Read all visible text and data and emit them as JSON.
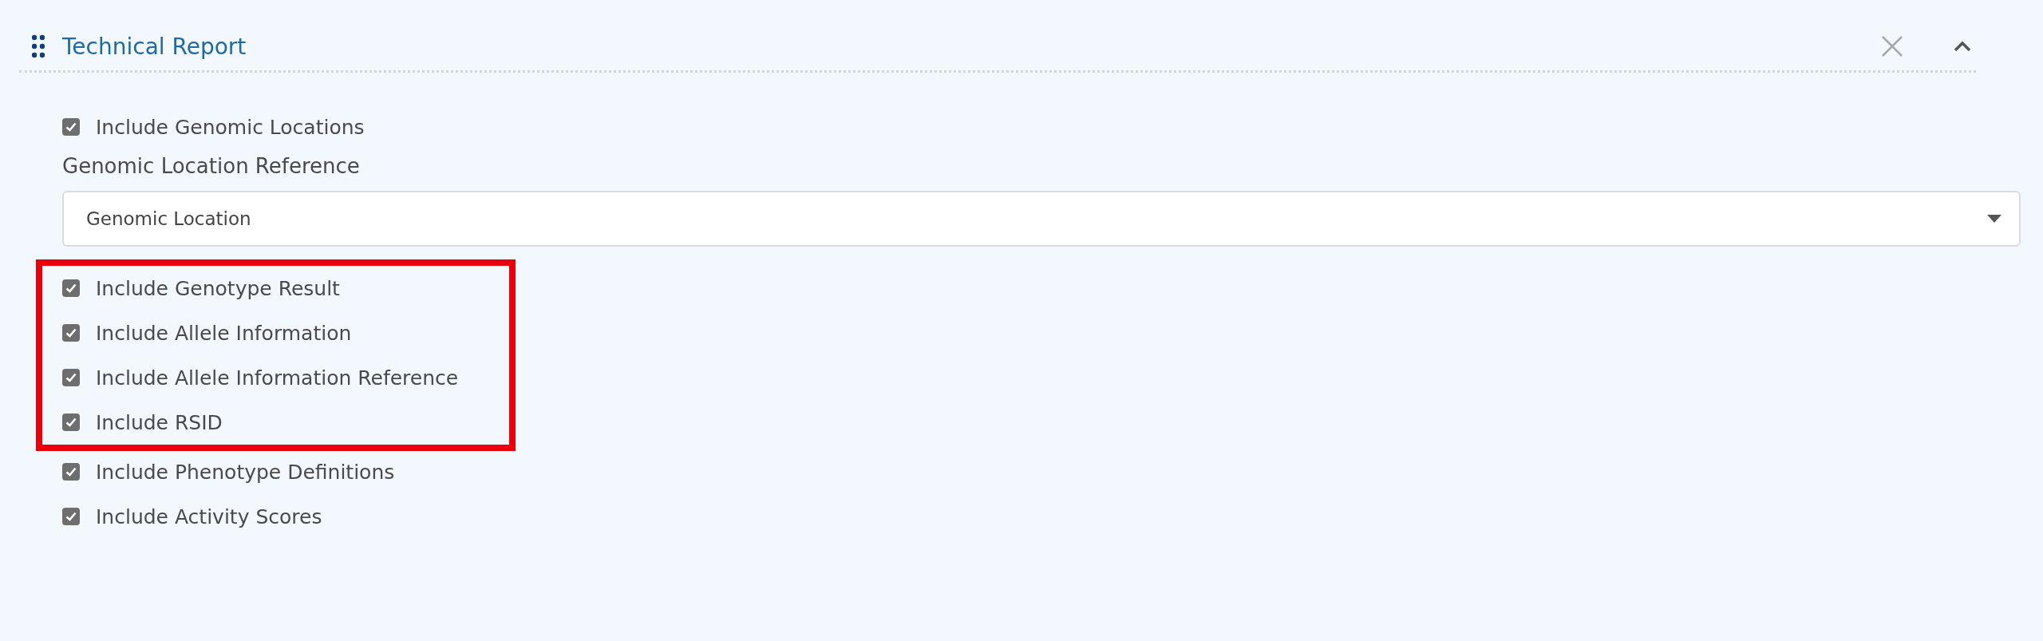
{
  "panel": {
    "title": "Technical Report",
    "expanded": true
  },
  "top_option": {
    "label": "Include Genomic Locations",
    "checked": true
  },
  "reference": {
    "label": "Genomic Location Reference",
    "value": "Genomic Location"
  },
  "highlighted_options": [
    {
      "label": "Include Genotype Result",
      "checked": true
    },
    {
      "label": "Include Allele Information",
      "checked": true
    },
    {
      "label": "Include Allele Information Reference",
      "checked": true
    },
    {
      "label": "Include RSID",
      "checked": true
    }
  ],
  "options": [
    {
      "label": "Include Phenotype Definitions",
      "checked": true
    },
    {
      "label": "Include Activity Scores",
      "checked": true
    }
  ]
}
